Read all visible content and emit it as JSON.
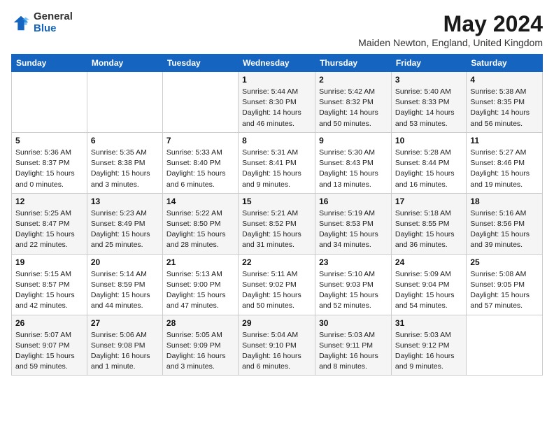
{
  "logo": {
    "general": "General",
    "blue": "Blue"
  },
  "header": {
    "month_year": "May 2024",
    "location": "Maiden Newton, England, United Kingdom"
  },
  "weekdays": [
    "Sunday",
    "Monday",
    "Tuesday",
    "Wednesday",
    "Thursday",
    "Friday",
    "Saturday"
  ],
  "weeks": [
    [
      {
        "day": "",
        "sunrise": "",
        "sunset": "",
        "daylight": ""
      },
      {
        "day": "",
        "sunrise": "",
        "sunset": "",
        "daylight": ""
      },
      {
        "day": "",
        "sunrise": "",
        "sunset": "",
        "daylight": ""
      },
      {
        "day": "1",
        "sunrise": "Sunrise: 5:44 AM",
        "sunset": "Sunset: 8:30 PM",
        "daylight": "Daylight: 14 hours and 46 minutes."
      },
      {
        "day": "2",
        "sunrise": "Sunrise: 5:42 AM",
        "sunset": "Sunset: 8:32 PM",
        "daylight": "Daylight: 14 hours and 50 minutes."
      },
      {
        "day": "3",
        "sunrise": "Sunrise: 5:40 AM",
        "sunset": "Sunset: 8:33 PM",
        "daylight": "Daylight: 14 hours and 53 minutes."
      },
      {
        "day": "4",
        "sunrise": "Sunrise: 5:38 AM",
        "sunset": "Sunset: 8:35 PM",
        "daylight": "Daylight: 14 hours and 56 minutes."
      }
    ],
    [
      {
        "day": "5",
        "sunrise": "Sunrise: 5:36 AM",
        "sunset": "Sunset: 8:37 PM",
        "daylight": "Daylight: 15 hours and 0 minutes."
      },
      {
        "day": "6",
        "sunrise": "Sunrise: 5:35 AM",
        "sunset": "Sunset: 8:38 PM",
        "daylight": "Daylight: 15 hours and 3 minutes."
      },
      {
        "day": "7",
        "sunrise": "Sunrise: 5:33 AM",
        "sunset": "Sunset: 8:40 PM",
        "daylight": "Daylight: 15 hours and 6 minutes."
      },
      {
        "day": "8",
        "sunrise": "Sunrise: 5:31 AM",
        "sunset": "Sunset: 8:41 PM",
        "daylight": "Daylight: 15 hours and 9 minutes."
      },
      {
        "day": "9",
        "sunrise": "Sunrise: 5:30 AM",
        "sunset": "Sunset: 8:43 PM",
        "daylight": "Daylight: 15 hours and 13 minutes."
      },
      {
        "day": "10",
        "sunrise": "Sunrise: 5:28 AM",
        "sunset": "Sunset: 8:44 PM",
        "daylight": "Daylight: 15 hours and 16 minutes."
      },
      {
        "day": "11",
        "sunrise": "Sunrise: 5:27 AM",
        "sunset": "Sunset: 8:46 PM",
        "daylight": "Daylight: 15 hours and 19 minutes."
      }
    ],
    [
      {
        "day": "12",
        "sunrise": "Sunrise: 5:25 AM",
        "sunset": "Sunset: 8:47 PM",
        "daylight": "Daylight: 15 hours and 22 minutes."
      },
      {
        "day": "13",
        "sunrise": "Sunrise: 5:23 AM",
        "sunset": "Sunset: 8:49 PM",
        "daylight": "Daylight: 15 hours and 25 minutes."
      },
      {
        "day": "14",
        "sunrise": "Sunrise: 5:22 AM",
        "sunset": "Sunset: 8:50 PM",
        "daylight": "Daylight: 15 hours and 28 minutes."
      },
      {
        "day": "15",
        "sunrise": "Sunrise: 5:21 AM",
        "sunset": "Sunset: 8:52 PM",
        "daylight": "Daylight: 15 hours and 31 minutes."
      },
      {
        "day": "16",
        "sunrise": "Sunrise: 5:19 AM",
        "sunset": "Sunset: 8:53 PM",
        "daylight": "Daylight: 15 hours and 34 minutes."
      },
      {
        "day": "17",
        "sunrise": "Sunrise: 5:18 AM",
        "sunset": "Sunset: 8:55 PM",
        "daylight": "Daylight: 15 hours and 36 minutes."
      },
      {
        "day": "18",
        "sunrise": "Sunrise: 5:16 AM",
        "sunset": "Sunset: 8:56 PM",
        "daylight": "Daylight: 15 hours and 39 minutes."
      }
    ],
    [
      {
        "day": "19",
        "sunrise": "Sunrise: 5:15 AM",
        "sunset": "Sunset: 8:57 PM",
        "daylight": "Daylight: 15 hours and 42 minutes."
      },
      {
        "day": "20",
        "sunrise": "Sunrise: 5:14 AM",
        "sunset": "Sunset: 8:59 PM",
        "daylight": "Daylight: 15 hours and 44 minutes."
      },
      {
        "day": "21",
        "sunrise": "Sunrise: 5:13 AM",
        "sunset": "Sunset: 9:00 PM",
        "daylight": "Daylight: 15 hours and 47 minutes."
      },
      {
        "day": "22",
        "sunrise": "Sunrise: 5:11 AM",
        "sunset": "Sunset: 9:02 PM",
        "daylight": "Daylight: 15 hours and 50 minutes."
      },
      {
        "day": "23",
        "sunrise": "Sunrise: 5:10 AM",
        "sunset": "Sunset: 9:03 PM",
        "daylight": "Daylight: 15 hours and 52 minutes."
      },
      {
        "day": "24",
        "sunrise": "Sunrise: 5:09 AM",
        "sunset": "Sunset: 9:04 PM",
        "daylight": "Daylight: 15 hours and 54 minutes."
      },
      {
        "day": "25",
        "sunrise": "Sunrise: 5:08 AM",
        "sunset": "Sunset: 9:05 PM",
        "daylight": "Daylight: 15 hours and 57 minutes."
      }
    ],
    [
      {
        "day": "26",
        "sunrise": "Sunrise: 5:07 AM",
        "sunset": "Sunset: 9:07 PM",
        "daylight": "Daylight: 15 hours and 59 minutes."
      },
      {
        "day": "27",
        "sunrise": "Sunrise: 5:06 AM",
        "sunset": "Sunset: 9:08 PM",
        "daylight": "Daylight: 16 hours and 1 minute."
      },
      {
        "day": "28",
        "sunrise": "Sunrise: 5:05 AM",
        "sunset": "Sunset: 9:09 PM",
        "daylight": "Daylight: 16 hours and 3 minutes."
      },
      {
        "day": "29",
        "sunrise": "Sunrise: 5:04 AM",
        "sunset": "Sunset: 9:10 PM",
        "daylight": "Daylight: 16 hours and 6 minutes."
      },
      {
        "day": "30",
        "sunrise": "Sunrise: 5:03 AM",
        "sunset": "Sunset: 9:11 PM",
        "daylight": "Daylight: 16 hours and 8 minutes."
      },
      {
        "day": "31",
        "sunrise": "Sunrise: 5:03 AM",
        "sunset": "Sunset: 9:12 PM",
        "daylight": "Daylight: 16 hours and 9 minutes."
      },
      {
        "day": "",
        "sunrise": "",
        "sunset": "",
        "daylight": ""
      }
    ]
  ]
}
